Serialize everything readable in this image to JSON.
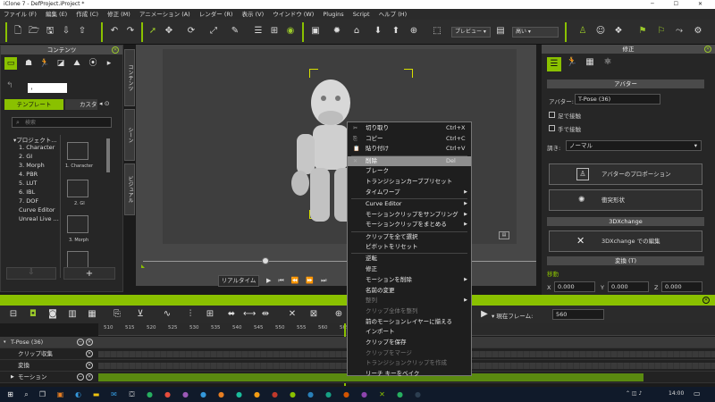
{
  "window": {
    "title": "iClone 7 - DefProject.iProject *",
    "controls": "─ ☐ ✕"
  },
  "menubar": [
    "ファイル (F)",
    "編集 (E)",
    "作成 (C)",
    "修正 (M)",
    "アニメーション (A)",
    "レンダー (R)",
    "表示 (V)",
    "ウインドウ (W)",
    "Plugins",
    "Script",
    "ヘルプ (H)"
  ],
  "toolbar": {
    "preview_label": "プレビュー",
    "quality_label": "高い"
  },
  "content_panel": {
    "title": "コンテンツ",
    "path_value": "，",
    "tab_template": "テンプレート",
    "tab_custom": "カスタ",
    "search_placeholder": "検索",
    "tree_root": "プロジェクト...",
    "tree_items": [
      "1. Character",
      "2. GI",
      "3. Morph",
      "4. PBR",
      "5. LUT",
      "6. IBL",
      "7. DOF",
      "Curve Editor",
      "Unreal Live ..."
    ],
    "thumbs": [
      "1. Character",
      "2. GI",
      "3. Morph",
      ""
    ],
    "vtabs": [
      "コンテンツ",
      "シーン",
      "ビジュアル"
    ]
  },
  "viewport": {
    "realtime_label": "リアルタイム"
  },
  "modify_panel": {
    "title": "修正",
    "avatar_section": "アバター",
    "avatar_label": "アバター:",
    "avatar_value": "T-Pose (36)",
    "foot_contact": "足で接触",
    "hand_contact": "手で接触",
    "shape_label": "調き:",
    "shape_value": "ノーマル",
    "proportion_btn": "アバターのプロポーション",
    "collision_btn": "衝突形状",
    "xchange_section": "3DXchange",
    "xchange_btn": "3DXchange での編集",
    "transform_section": "変換 (T)",
    "move_label": "移動",
    "x_label": "X",
    "x_value": "0.000",
    "y_label": "Y",
    "y_value": "0.000",
    "z_label": "Z",
    "z_value": "0.000"
  },
  "timeline": {
    "current_frame_label": "現在フレーム:",
    "current_frame": "560",
    "ticks": [
      "510",
      "515",
      "520",
      "525",
      "530",
      "535",
      "540",
      "545",
      "550",
      "555",
      "560",
      "565",
      "570",
      "575"
    ],
    "rows": [
      {
        "name": "T-Pose (36)"
      },
      {
        "name": "クリップ収集"
      },
      {
        "name": "変換"
      },
      {
        "name": "モーション"
      }
    ]
  },
  "context_menu": {
    "items": [
      {
        "label": "切り取り",
        "shortcut": "Ctrl+X",
        "icon": "✂",
        "state": "normal"
      },
      {
        "label": "コピー",
        "shortcut": "Ctrl+C",
        "icon": "⎘",
        "state": "normal"
      },
      {
        "label": "貼り付け",
        "shortcut": "Ctrl+V",
        "icon": "📋",
        "state": "normal"
      },
      {
        "label": "削除",
        "shortcut": "Del",
        "icon": "✕",
        "state": "highlighted"
      },
      {
        "label": "ブレーク",
        "shortcut": "",
        "icon": "",
        "state": "normal"
      },
      {
        "label": "トランジションカーブプリセット",
        "shortcut": "",
        "icon": "",
        "state": "normal"
      },
      {
        "label": "タイムワープ",
        "shortcut": "",
        "icon": "",
        "state": "submenu"
      },
      {
        "label": "Curve Editor",
        "shortcut": "",
        "icon": "",
        "state": "submenu"
      },
      {
        "label": "モーションクリップをサンプリング",
        "shortcut": "",
        "icon": "",
        "state": "submenu"
      },
      {
        "label": "モーションクリップをまとめる",
        "shortcut": "",
        "icon": "",
        "state": "submenu"
      },
      {
        "label": "クリップを全て選択",
        "shortcut": "",
        "icon": "",
        "state": "normal"
      },
      {
        "label": "ピボットをリセット",
        "shortcut": "",
        "icon": "",
        "state": "normal"
      },
      {
        "label": "逆転",
        "shortcut": "",
        "icon": "",
        "state": "normal"
      },
      {
        "label": "修正",
        "shortcut": "",
        "icon": "",
        "state": "normal"
      },
      {
        "label": "モーションを削除",
        "shortcut": "",
        "icon": "",
        "state": "submenu"
      },
      {
        "label": "名前の変更",
        "shortcut": "",
        "icon": "",
        "state": "normal"
      },
      {
        "label": "整列",
        "shortcut": "",
        "icon": "",
        "state": "disabled-submenu"
      },
      {
        "label": "クリップ全体を整列",
        "shortcut": "",
        "icon": "",
        "state": "disabled"
      },
      {
        "label": "前のモーションレイヤーに揃える",
        "shortcut": "",
        "icon": "",
        "state": "normal"
      },
      {
        "label": "インポート",
        "shortcut": "",
        "icon": "",
        "state": "normal"
      },
      {
        "label": "クリップを保存",
        "shortcut": "",
        "icon": "",
        "state": "normal"
      },
      {
        "label": "クリップをマージ",
        "shortcut": "",
        "icon": "",
        "state": "disabled"
      },
      {
        "label": "トランジションクリップを作成",
        "shortcut": "",
        "icon": "",
        "state": "disabled"
      },
      {
        "label": "リーチ キーをベイク",
        "shortcut": "",
        "icon": "",
        "state": "normal"
      }
    ]
  },
  "taskbar": {
    "time": "14:00"
  },
  "colors": {
    "accent": "#8ac100",
    "panel": "#262626",
    "highlight": "#8e8e8e"
  }
}
